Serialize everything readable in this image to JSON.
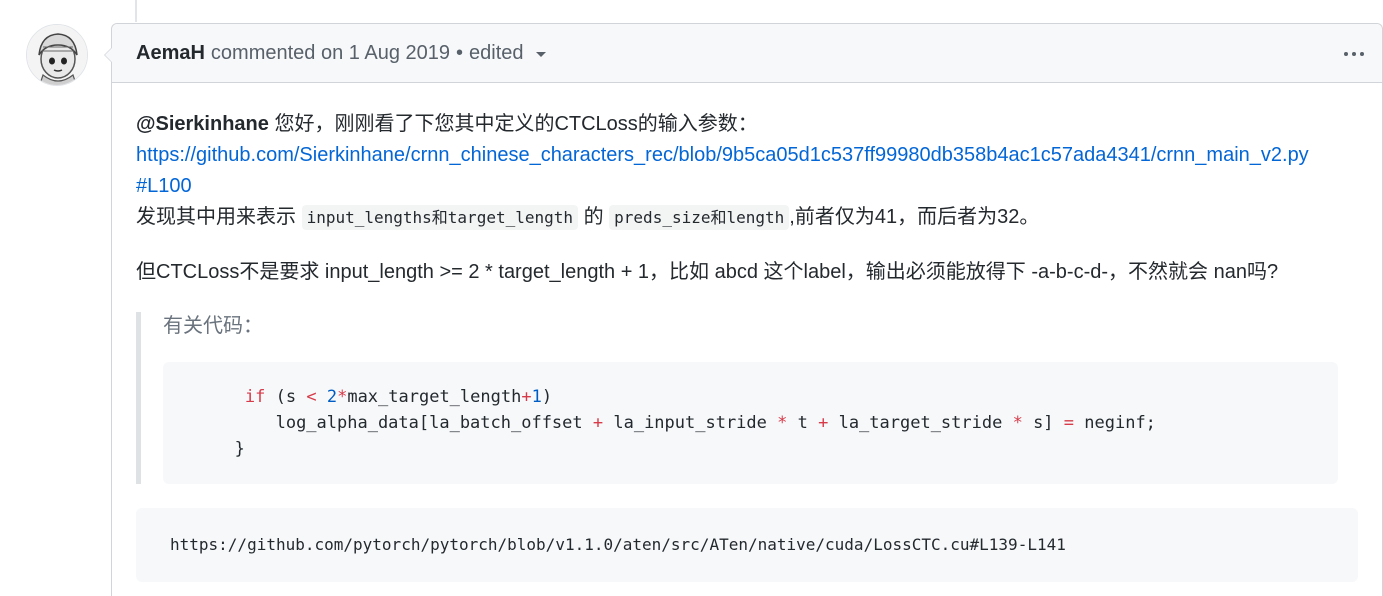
{
  "comment": {
    "author": "AemaH",
    "meta_text": "commented on 1 Aug 2019",
    "separator": "•",
    "edited_label": "edited",
    "body": {
      "mention": "@Sierkinhane",
      "intro_text": " 您好，刚刚看了下您其中定义的CTCLoss的输入参数：",
      "link_line1": "https://github.com/Sierkinhane/crnn_chinese_characters_rec/blob/9b5ca05d1c537ff99980db358b4ac1c57ada4341/crnn_main_v2.py",
      "link_line2": "#L100",
      "finding_prefix": "发现其中用来表示",
      "code1": "input_lengths和target_length",
      "finding_mid": "的",
      "code2": "preds_size和length",
      "finding_suffix": ",前者仅为41，而后者为32。",
      "question": "但CTCLoss不是要求 input_length >= 2 * target_length + 1，比如 abcd 这个label，输出必须能放得下 -a-b-c-d-，不然就会 nan吗?",
      "quote_label": "有关代码：",
      "code_lines": {
        "l1_kw": "if",
        "l1_a": " (s ",
        "l1_op1": "<",
        "l1_sp": " ",
        "l1_num1": "2",
        "l1_op2": "*",
        "l1_b": "max_target_length",
        "l1_op3": "+",
        "l1_num2": "1",
        "l1_c": ")",
        "l2_a": "log_alpha_data[la_batch_offset ",
        "l2_op1": "+",
        "l2_b": " la_input_stride ",
        "l2_op2": "*",
        "l2_c": " t ",
        "l2_op3": "+",
        "l2_d": " la_target_stride ",
        "l2_op4": "*",
        "l2_e": " s] ",
        "l2_op5": "=",
        "l2_f": " neginf;",
        "l3": "}"
      },
      "reference_url": "https://github.com/pytorch/pytorch/blob/v1.1.0/aten/src/ATen/native/cuda/LossCTC.cu#L139-L141"
    }
  },
  "icons": {
    "avatar": "avatar-image",
    "more": "kebab-horizontal-icon",
    "caret": "caret-down-icon"
  },
  "colors": {
    "link": "#0366d6",
    "header_bg": "#f6f8fa",
    "border": "#d1d5da",
    "keyword": "#d73a49",
    "number": "#005cc5"
  }
}
